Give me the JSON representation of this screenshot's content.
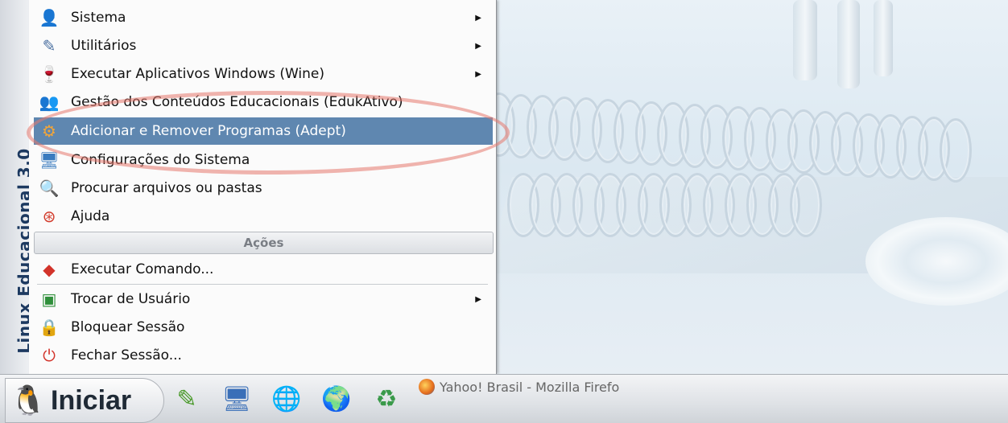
{
  "side_banner": "Linux Educacional 3.0",
  "menu": {
    "items": [
      {
        "label": "Sistema",
        "icon": "system-icon",
        "submenu": true
      },
      {
        "label": "Utilitários",
        "icon": "utilities-icon",
        "submenu": true
      },
      {
        "label": "Executar Aplicativos Windows (Wine)",
        "icon": "wine-icon",
        "submenu": true
      },
      {
        "label": "Gestão dos Conteúdos Educacionais (EdukAtivo)",
        "icon": "edukativo-icon",
        "submenu": false
      },
      {
        "label": "Adicionar e Remover Programas (Adept)",
        "icon": "adept-icon",
        "submenu": false,
        "highlighted": true
      },
      {
        "label": "Configurações do Sistema",
        "icon": "system-settings-icon",
        "submenu": false
      },
      {
        "label": "Procurar arquivos ou pastas",
        "icon": "search-icon",
        "submenu": false
      },
      {
        "label": "Ajuda",
        "icon": "help-icon",
        "submenu": false
      }
    ],
    "section_header": "Ações",
    "actions": [
      {
        "label": "Executar Comando...",
        "icon": "run-command-icon",
        "submenu": false
      },
      {
        "label": "Trocar de Usuário",
        "icon": "switch-user-icon",
        "submenu": true
      },
      {
        "label": "Bloquear Sessão",
        "icon": "lock-icon",
        "submenu": false
      },
      {
        "label": "Fechar Sessão...",
        "icon": "logout-icon",
        "submenu": false
      }
    ]
  },
  "taskbar": {
    "start_label": "Iniciar",
    "launchers": [
      "paint-icon",
      "desktop-icon",
      "network-icon",
      "browser-globe-icon",
      "trash-icon"
    ],
    "window_title": "Yahoo! Brasil - Mozilla Firefo"
  },
  "colors": {
    "highlight": "#5f87b0",
    "oval": "#e6786e"
  }
}
